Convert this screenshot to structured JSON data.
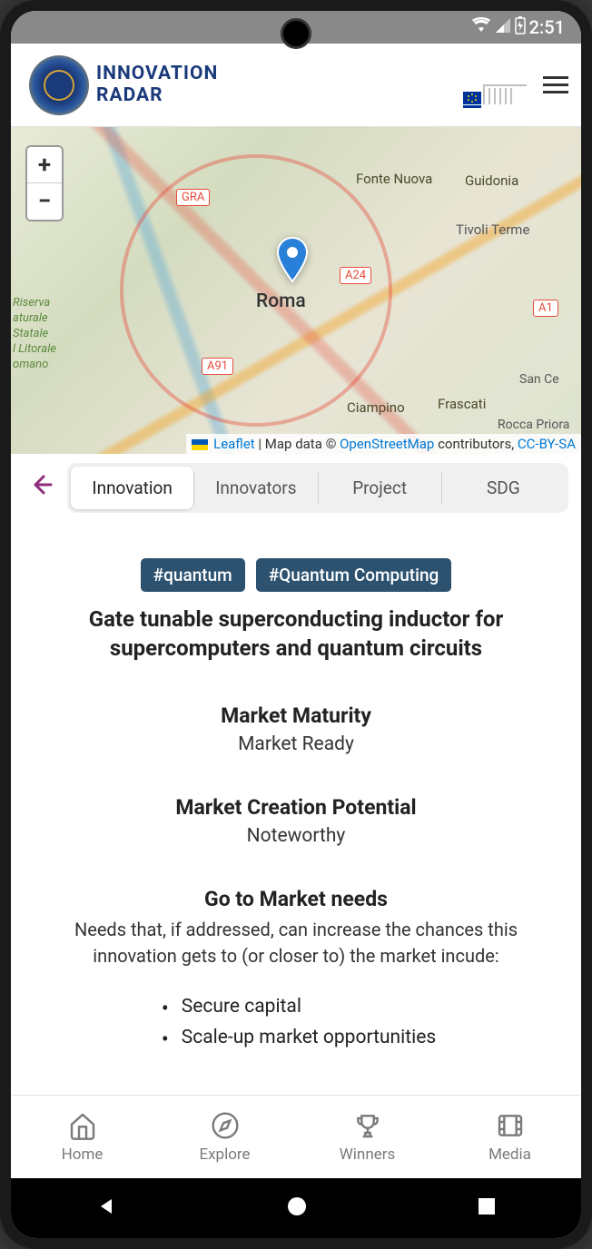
{
  "status_bar": {
    "time": "2:51"
  },
  "header": {
    "logo_line1": "INNOVATION",
    "logo_line2": "RADAR",
    "ec_label": "European Commission"
  },
  "map": {
    "zoom_in": "+",
    "zoom_out": "−",
    "center_city": "Roma",
    "labels": {
      "fontenuova": "Fonte Nuova",
      "guidonia": "Guidonia",
      "tivoli": "Tivoli Terme",
      "ciampino": "Ciampino",
      "frascati": "Frascati",
      "roccap": "Rocca Priora",
      "sanc": "San Ce",
      "riserva": "Riserva\naturale\nStatale\nl Litorale\nomano",
      "gra": "GRA",
      "a24": "A24",
      "a1": "A1",
      "a91": "A91"
    },
    "attribution": {
      "leaflet": "Leaflet",
      "mapdata": " | Map data © ",
      "osm": "OpenStreetMap",
      "contrib": " contributors, ",
      "license": "CC-BY-SA"
    }
  },
  "tabs": {
    "items": [
      {
        "label": "Innovation",
        "active": true
      },
      {
        "label": "Innovators",
        "active": false
      },
      {
        "label": "Project",
        "active": false
      },
      {
        "label": "SDG",
        "active": false
      }
    ]
  },
  "tags": [
    "#quantum",
    "#Quantum Computing"
  ],
  "title": "Gate tunable superconducting inductor for supercomputers and quantum circuits",
  "sections": {
    "maturity": {
      "heading": "Market Maturity",
      "value": "Market Ready"
    },
    "potential": {
      "heading": "Market Creation Potential",
      "value": "Noteworthy"
    },
    "needs": {
      "heading": "Go to Market needs",
      "description": "Needs that, if addressed, can increase the chances this innovation gets to (or closer to) the market incude:",
      "items": [
        "Secure capital",
        "Scale-up market opportunities"
      ]
    }
  },
  "bottom_nav": {
    "home": "Home",
    "explore": "Explore",
    "winners": "Winners",
    "media": "Media"
  }
}
